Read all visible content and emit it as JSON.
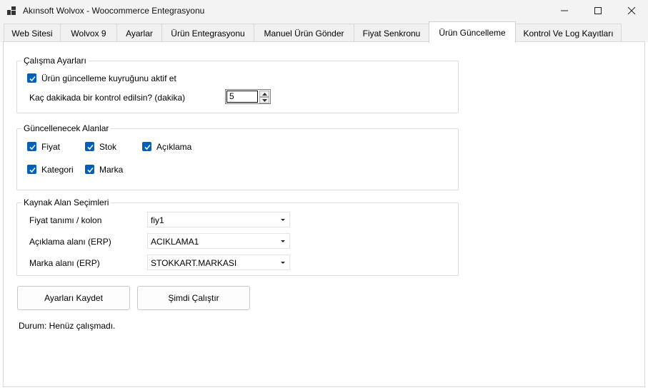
{
  "window": {
    "title": "Akınsoft Wolvox - Woocommerce Entegrasyonu"
  },
  "tabs": [
    {
      "label": "Web Sitesi"
    },
    {
      "label": "Wolvox 9"
    },
    {
      "label": "Ayarlar"
    },
    {
      "label": "Ürün Entegrasyonu"
    },
    {
      "label": "Manuel Ürün Gönder"
    },
    {
      "label": "Fiyat Senkronu"
    },
    {
      "label": "Ürün Güncelleme",
      "active": true
    },
    {
      "label": "Kontrol Ve Log Kayıtları"
    }
  ],
  "work_settings": {
    "title": "Çalışma Ayarları",
    "queue_active_label": "Ürün güncelleme kuyruğunu aktif et",
    "queue_active_checked": true,
    "interval_label": "Kaç dakikada bir kontrol edilsin? (dakika)",
    "interval_value": "5"
  },
  "fields": {
    "title": "Güncellenecek Alanlar",
    "items": [
      {
        "label": "Fiyat",
        "checked": true
      },
      {
        "label": "Stok",
        "checked": true
      },
      {
        "label": "Açıklama",
        "checked": true
      },
      {
        "label": "Kategori",
        "checked": true
      },
      {
        "label": "Marka",
        "checked": true
      }
    ]
  },
  "source": {
    "title": "Kaynak Alan Seçimleri",
    "rows": [
      {
        "label": "Fiyat tanımı / kolon",
        "value": "fiy1"
      },
      {
        "label": "Açıklama alanı (ERP)",
        "value": "ACIKLAMA1"
      },
      {
        "label": "Marka alanı (ERP)",
        "value": "STOKKART.MARKASI"
      }
    ]
  },
  "actions": {
    "save_label": "Ayarları Kaydet",
    "run_label": "Şimdi Çalıştır"
  },
  "status": {
    "text": "Durum: Henüz çalışmadı."
  },
  "colors": {
    "accent": "#005fb8",
    "titlebar": "#f3f3f3",
    "border": "#dcdcdc"
  }
}
